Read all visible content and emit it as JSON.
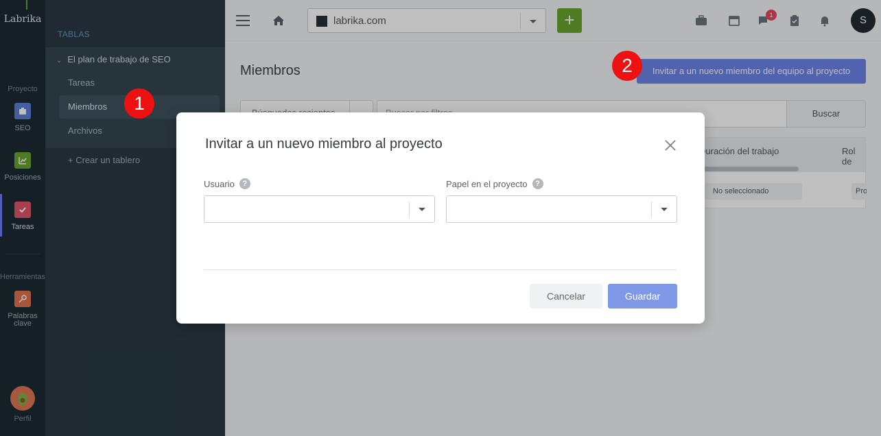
{
  "app": {
    "logo": "Labrika"
  },
  "rail": {
    "project_label": "Proyecto",
    "tools_label": "Herramientas",
    "items": [
      {
        "label": "SEO",
        "icon": "briefcase-icon",
        "color": "#5b7fd6"
      },
      {
        "label": "Posiciones",
        "icon": "chart-icon",
        "color": "#6aa62e"
      },
      {
        "label": "Tareas",
        "icon": "check-icon",
        "color": "#e0556a"
      },
      {
        "label": "Palabras clave",
        "icon": "key-icon",
        "color": "#e0734d"
      }
    ],
    "profile_label": "Perfil"
  },
  "sidebar": {
    "heading": "TABLAS",
    "group_title": "El plan de trabajo de SEO",
    "items": [
      {
        "label": "Tareas"
      },
      {
        "label": "Miembros"
      },
      {
        "label": "Archivos"
      }
    ],
    "create_label": "+ Crear un tablero"
  },
  "topbar": {
    "domain": "labrika.com",
    "add_label": "+",
    "badge_count": "1",
    "user_initial": "S"
  },
  "main": {
    "title": "Miembros",
    "invite_button": "Invitar a un nuevo miembro del equipo al proyecto",
    "filter_text": "Búsquedas recientes",
    "search_text": "Buscar por filtros...",
    "search_button": "Buscar",
    "table": {
      "col_duration": "Duración del trabajo",
      "col_role": "Rol de",
      "chip_1": "No seleccionado",
      "chip_2": "Pro"
    }
  },
  "markers": {
    "one": "1",
    "two": "2"
  },
  "modal": {
    "title": "Invitar a un nuevo miembro al proyecto",
    "user_label": "Usuario",
    "role_label": "Papel en el proyecto",
    "help_glyph": "?",
    "cancel": "Cancelar",
    "save": "Guardar"
  }
}
